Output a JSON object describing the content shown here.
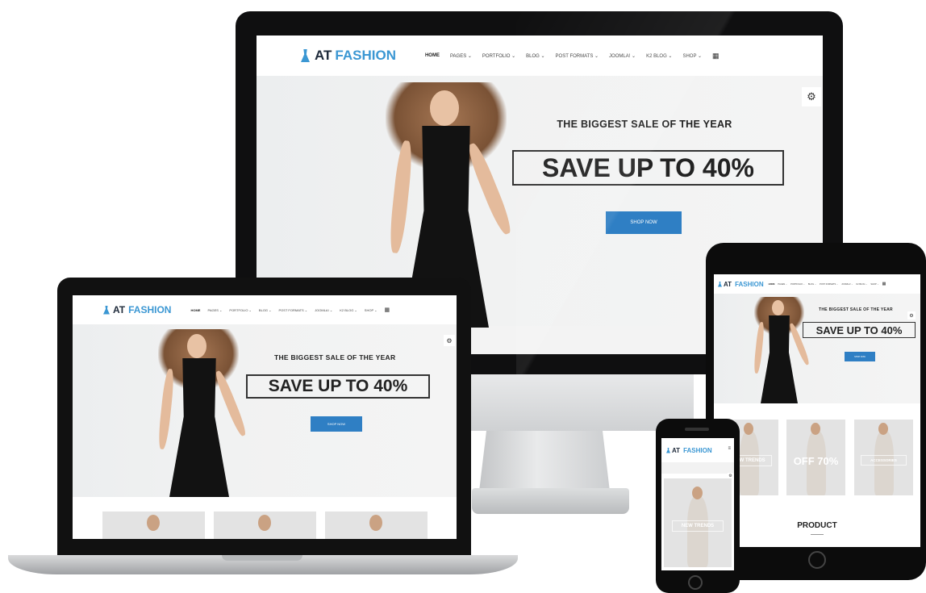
{
  "site": {
    "logo_left": "AT",
    "logo_right": "FASHION",
    "menu": [
      "HOME",
      "PAGES ⌄",
      "PORTFOLIO ⌄",
      "BLOG ⌄",
      "POST FORMATS ⌄",
      "JOOMLA! ⌄",
      "K2 BLOG ⌄",
      "SHOP ⌄"
    ],
    "menu_icon": "grid-icon",
    "hero_title_part1": "THE BIGGEST",
    "hero_title_part2": "SALE OF THE YEAR",
    "save_part1": "SAVE UP",
    "save_part2": "TO 40%",
    "shop_button": "SHOP NOW",
    "gear_icon": "gear-icon"
  },
  "tablet": {
    "thumb_labels": [
      "NEW TRENDS",
      "OFF 70%",
      "ACCESSORIES"
    ],
    "section_title": "PRODUCT"
  },
  "phone": {
    "thumb_label": "NEW TRENDS"
  },
  "colors": {
    "accent": "#3b97d3",
    "button": "#2f7fc4",
    "frame": "#0f0f10"
  }
}
